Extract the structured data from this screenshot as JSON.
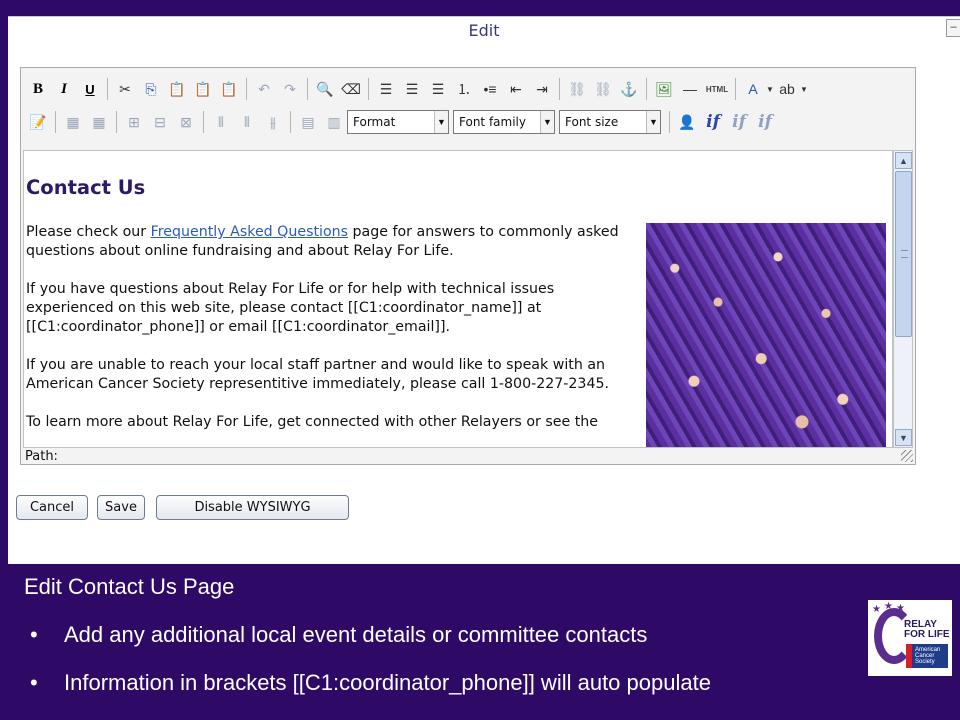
{
  "window": {
    "title": "Edit",
    "tab_glyph": "–"
  },
  "toolbar": {
    "row1": [
      {
        "name": "bold-button",
        "glyph": "B",
        "cls": "bold"
      },
      {
        "name": "italic-button",
        "glyph": "I",
        "cls": "ital"
      },
      {
        "name": "underline-button",
        "glyph": "U",
        "cls": "undl"
      },
      {
        "sep": true
      },
      {
        "name": "cut-icon",
        "glyph": "✂"
      },
      {
        "name": "copy-icon",
        "glyph": "⎘",
        "cls": "blue"
      },
      {
        "name": "paste-icon",
        "glyph": "📋"
      },
      {
        "name": "paste-text-icon",
        "glyph": "📋"
      },
      {
        "name": "paste-word-icon",
        "glyph": "📋"
      },
      {
        "sep": true
      },
      {
        "name": "undo-icon",
        "glyph": "↶",
        "cls": "dim"
      },
      {
        "name": "redo-icon",
        "glyph": "↷",
        "cls": "dim"
      },
      {
        "sep": true
      },
      {
        "name": "find-replace-icon",
        "glyph": "🔍"
      },
      {
        "name": "clean-format-icon",
        "glyph": "⌫"
      },
      {
        "sep": true
      },
      {
        "name": "align-left-icon",
        "glyph": "☰"
      },
      {
        "name": "align-center-icon",
        "glyph": "☰"
      },
      {
        "name": "align-right-icon",
        "glyph": "☰"
      },
      {
        "name": "numbered-list-icon",
        "glyph": "⒈"
      },
      {
        "name": "bullet-list-icon",
        "glyph": "•≡"
      },
      {
        "name": "outdent-icon",
        "glyph": "⇤"
      },
      {
        "name": "indent-icon",
        "glyph": "⇥"
      },
      {
        "sep": true
      },
      {
        "name": "link-icon",
        "glyph": "⛓",
        "cls": "dim"
      },
      {
        "name": "unlink-icon",
        "glyph": "⛓",
        "cls": "dim"
      },
      {
        "name": "anchor-icon",
        "glyph": "⚓",
        "cls": "blue"
      },
      {
        "sep": true
      },
      {
        "name": "insert-image-icon",
        "glyph": "🖼",
        "cls": "green"
      },
      {
        "name": "horizontal-rule-icon",
        "glyph": "—"
      },
      {
        "name": "html-source-icon",
        "glyph": "HTML",
        "cls": "html"
      },
      {
        "sep": true
      },
      {
        "name": "text-color-icon",
        "glyph": "A",
        "cls": "blue",
        "dd": true
      },
      {
        "name": "highlight-color-icon",
        "glyph": "ab",
        "dd": true
      }
    ],
    "row2": [
      {
        "name": "edit-style-icon",
        "glyph": "📝"
      },
      {
        "sep": true
      },
      {
        "name": "insert-table-icon",
        "glyph": "▦",
        "cls": "dim"
      },
      {
        "name": "table-props-icon",
        "glyph": "▦",
        "cls": "dim"
      },
      {
        "sep": true
      },
      {
        "name": "insert-row-icon",
        "glyph": "⊞",
        "cls": "dim"
      },
      {
        "name": "insert-row-after-icon",
        "glyph": "⊟",
        "cls": "dim"
      },
      {
        "name": "delete-row-icon",
        "glyph": "⊠",
        "cls": "dim"
      },
      {
        "sep": true
      },
      {
        "name": "insert-col-icon",
        "glyph": "⫴",
        "cls": "dim"
      },
      {
        "name": "insert-col-after-icon",
        "glyph": "⫴",
        "cls": "dim"
      },
      {
        "name": "delete-col-icon",
        "glyph": "⫵",
        "cls": "dim"
      },
      {
        "sep": true
      },
      {
        "name": "merge-cells-icon",
        "glyph": "▤",
        "cls": "dim"
      },
      {
        "name": "split-cells-icon",
        "glyph": "▥",
        "cls": "dim"
      }
    ],
    "selects": [
      {
        "name": "format-select",
        "value": "Format",
        "width": 102
      },
      {
        "name": "font-family-select",
        "value": "Font family",
        "width": 102
      },
      {
        "name": "font-size-select",
        "value": "Font size",
        "width": 102
      }
    ],
    "row2_tail": [
      {
        "name": "insert-field-icon",
        "glyph": "👤",
        "cls": "blue"
      },
      {
        "name": "if-icon",
        "glyph": "if",
        "cls": "ifb"
      },
      {
        "name": "if-edit-icon",
        "glyph": "if",
        "cls": "ifd"
      },
      {
        "name": "if-else-icon",
        "glyph": "if",
        "cls": "ifd"
      }
    ]
  },
  "document": {
    "heading": "Contact Us",
    "p1_before": "Please check our ",
    "p1_link": "Frequently Asked Questions",
    "p1_after": " page for answers to commonly asked questions about online fundraising and about Relay For Life.",
    "p2": "If you have questions about Relay For Life or for help with technical issues experienced on this web site, please contact [[C1:coordinator_name]] at [[C1:coordinator_phone]] or email [[C1:coordinator_email]].",
    "p3": "If you are unable to reach your local staff partner and would like to speak with an American Cancer Society representitive immediately, please call 1-800-227-2345.",
    "p4": "To learn more about Relay For Life, get connected with other Relayers or see the"
  },
  "pathbar": {
    "label": "Path:"
  },
  "buttons": {
    "cancel": "Cancel",
    "save": "Save",
    "disable": "Disable WYSIWYG"
  },
  "footer": {
    "title": "Edit Contact Us Page",
    "bullets": [
      "Add any additional local event details or committee contacts",
      "Information in brackets [[C1:coordinator_phone]] will auto populate"
    ],
    "bullet_glyph": "•"
  },
  "logo": {
    "line1": "RELAY",
    "line2": "FOR LIFE",
    "acs1": "American",
    "acs2": "Cancer",
    "acs3": "Society"
  },
  "colors": {
    "background": "#2e0a66",
    "accent_red": "#e0141e",
    "link": "#2b5cb8",
    "heading": "#2b1a66"
  }
}
